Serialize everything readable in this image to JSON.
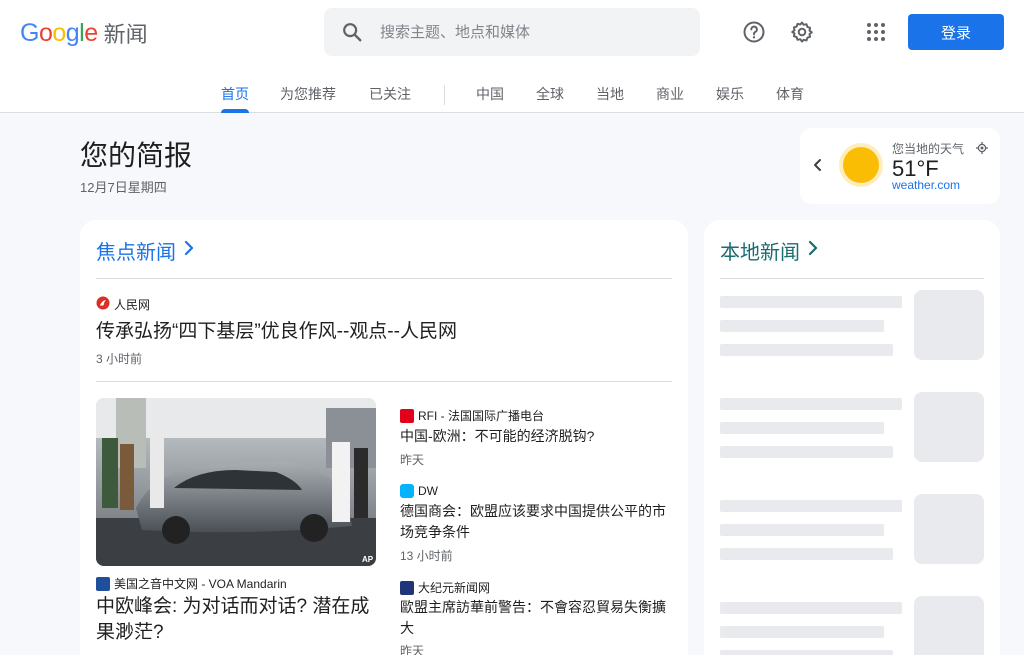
{
  "header": {
    "logo_letters": [
      "G",
      "o",
      "o",
      "g",
      "l",
      "e"
    ],
    "product": "新闻",
    "search": {
      "placeholder": "搜索主题、地点和媒体",
      "icon": "search-icon"
    },
    "help_icon": "help-icon",
    "settings_icon": "gear-icon",
    "apps_icon": "apps-grid-icon",
    "login_label": "登录"
  },
  "tabs": [
    "首页",
    "为您推荐",
    "已关注",
    "中国",
    "全球",
    "当地",
    "商业",
    "娱乐",
    "体育"
  ],
  "active_tab": "首页",
  "briefing": {
    "title": "您的简报",
    "date": "12月7日星期四"
  },
  "weather": {
    "label": "您当地的天气",
    "temp": "51°F",
    "source": "weather.com",
    "condition_icon": "sun-icon"
  },
  "top_stories": {
    "heading": "焦点新闻",
    "lead": {
      "source": "人民网",
      "title": "传承弘扬“四下基层”优良作风--观点--人民网",
      "time": "3 小时前"
    },
    "feature": {
      "source": "美国之音中文网 - VOA Mandarin",
      "title": "中欧峰会: 为对话而对话? 潜在成果渺茫?",
      "photo_credit": "AP"
    },
    "side": [
      {
        "source": "RFI - 法国国际广播电台",
        "title": "中国-欧洲：不可能的经济脱钩?",
        "time": "昨天"
      },
      {
        "source": "DW",
        "title": "德国商会：欧盟应该要求中国提供公平的市场竞争条件",
        "time": "13 小时前"
      },
      {
        "source": "大纪元新闻网",
        "title": "歐盟主席訪華前警告：不會容忍貿易失衡擴大",
        "time": "昨天"
      }
    ]
  },
  "local_news": {
    "heading": "本地新闻"
  },
  "colors": {
    "accent": "#1a73e8",
    "local_heading": "#1a6c72",
    "skeleton": "#e8eaed"
  }
}
